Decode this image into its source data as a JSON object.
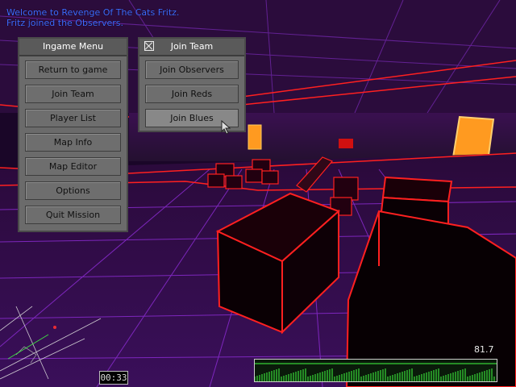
{
  "chat": [
    "Welcome to Revenge Of The Cats Fritz.",
    "Fritz joined the Observers."
  ],
  "ingame_menu": {
    "title": "Ingame Menu",
    "buttons": [
      "Return to game",
      "Join Team",
      "Player List",
      "Map Info",
      "Map Editor",
      "Options",
      "Quit Mission"
    ]
  },
  "join_team": {
    "title": "Join Team",
    "buttons": [
      "Join Observers",
      "Join Reds",
      "Join Blues"
    ],
    "hovered": "Join Blues"
  },
  "hud": {
    "timer": "00:33",
    "fps": "81.7"
  },
  "colors": {
    "neon_edge": "#ff2020",
    "floor_grid": "#8a2bd0",
    "chat_text": "#3f6bff",
    "graph_line": "#40ff40"
  }
}
